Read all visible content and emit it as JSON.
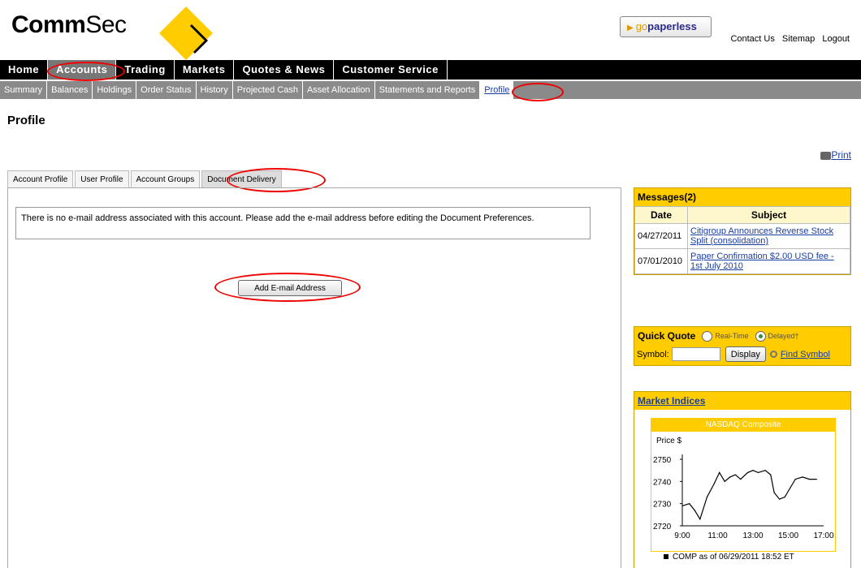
{
  "header": {
    "logo_bold": "Comm",
    "logo_regular": "Sec",
    "paperless_go": "go",
    "paperless_word": "paperless",
    "links": [
      "Contact Us",
      "Sitemap",
      "Logout"
    ]
  },
  "main_nav": [
    "Home",
    "Accounts",
    "Trading",
    "Markets",
    "Quotes & News",
    "Customer Service"
  ],
  "sub_nav": [
    "Summary",
    "Balances",
    "Holdings",
    "Order Status",
    "History",
    "Projected Cash",
    "Asset Allocation",
    "Statements and Reports",
    "Profile"
  ],
  "page": {
    "title": "Profile",
    "print_label": "Print"
  },
  "tabs": [
    "Account Profile",
    "User Profile",
    "Account Groups",
    "Document Delivery"
  ],
  "notice": "There is no e-mail address associated with this account. Please add the e-mail address before editing the Document Preferences.",
  "add_email_button": "Add E-mail Address",
  "messages": {
    "title": "Messages(2)",
    "col_date": "Date",
    "col_subject": "Subject",
    "rows": [
      {
        "date": "04/27/2011",
        "subject": "Citigroup Announces Reverse Stock Split (consolidation)"
      },
      {
        "date": "07/01/2010",
        "subject": "Paper Confirmation $2.00 USD fee - 1st July 2010"
      }
    ]
  },
  "quick_quote": {
    "title": "Quick Quote",
    "opt_realtime": "Real-Time",
    "opt_delayed": "Delayed†",
    "selected": "Delayed",
    "symbol_label": "Symbol:",
    "symbol_value": "",
    "display_button": "Display",
    "find_symbol": "Find Symbol"
  },
  "market_indices": {
    "title": "Market Indices",
    "footer": "COMP as of 06/29/2011 18:52 ET"
  },
  "chart_data": {
    "type": "line",
    "title": "NASDAQ Composite",
    "ylabel": "Price $",
    "xlabel": "",
    "x_ticks": [
      "9:00",
      "11:00",
      "13:00",
      "15:00",
      "17:00"
    ],
    "y_ticks": [
      2720,
      2730,
      2740,
      2750
    ],
    "ylim": [
      2720,
      2750
    ],
    "xlim": [
      9,
      17
    ],
    "series": [
      {
        "x": [
          9.0,
          9.4,
          9.7,
          10.0,
          10.4,
          10.8,
          11.1,
          11.4,
          11.7,
          12.0,
          12.3,
          12.7,
          13.0,
          13.3,
          13.7,
          14.0,
          14.2,
          14.5,
          14.8,
          15.1,
          15.4,
          15.8,
          16.2,
          16.6
        ],
        "y": [
          2729,
          2730,
          2727,
          2723,
          2733,
          2739,
          2744,
          2740,
          2742,
          2743,
          2741,
          2744,
          2745,
          2744,
          2745,
          2743,
          2735,
          2732,
          2733,
          2737,
          2741,
          2742,
          2741,
          2741
        ]
      }
    ]
  },
  "colors": {
    "accent_yellow": "#ffcc00",
    "annotation_red": "#e00000",
    "link_blue": "#1a3ea0"
  }
}
